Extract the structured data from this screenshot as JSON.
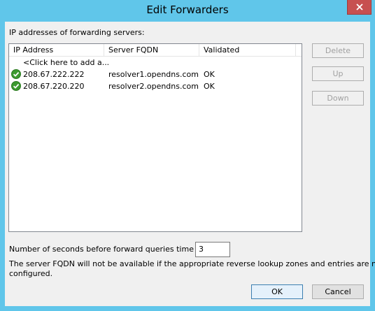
{
  "window": {
    "title": "Edit Forwarders"
  },
  "forwarders": {
    "section_label": "IP addresses of forwarding servers:",
    "columns": [
      "IP Address",
      "Server FQDN",
      "Validated"
    ],
    "add_placeholder": "<Click here to add a...",
    "rows": [
      {
        "ip": "208.67.222.222",
        "fqdn": "resolver1.opendns.com",
        "validated": "OK",
        "icon": "check-icon"
      },
      {
        "ip": "208.67.220.220",
        "fqdn": "resolver2.opendns.com",
        "validated": "OK",
        "icon": "check-icon"
      }
    ],
    "buttons": {
      "delete": "Delete",
      "up": "Up",
      "down": "Down"
    }
  },
  "timeout": {
    "label": "Number of seconds before forward queries time out:",
    "value": "3"
  },
  "note": {
    "line1": "The server FQDN will not be available if the appropriate reverse lookup zones and entries are not",
    "line2": "configured."
  },
  "footer": {
    "ok": "OK",
    "cancel": "Cancel"
  },
  "colors": {
    "titlebar": "#60c6ea",
    "close": "#c75050",
    "check": "#3c9a2e"
  }
}
